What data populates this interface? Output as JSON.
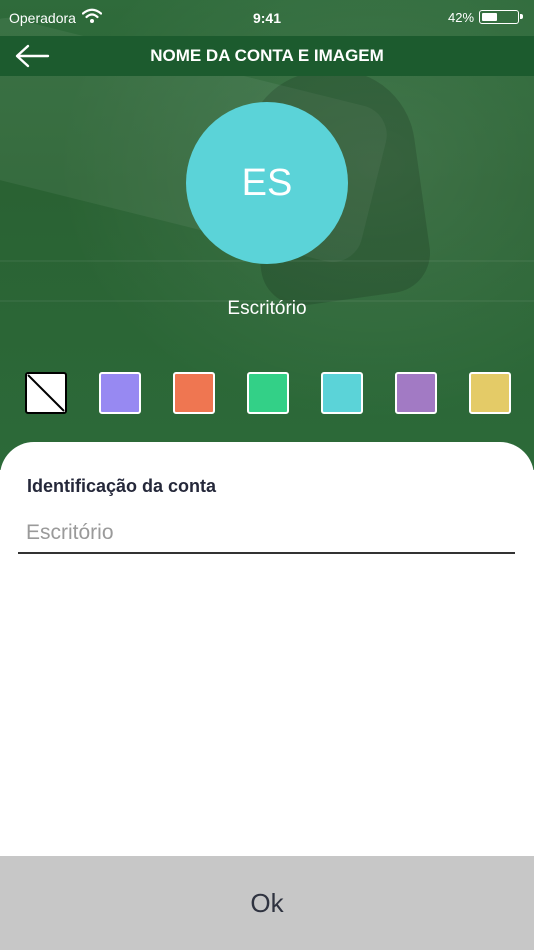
{
  "status_bar": {
    "carrier": "Operadora",
    "time": "9:41",
    "battery_percent": "42%",
    "battery_level": 0.42,
    "wifi_icon": "wifi-icon"
  },
  "header": {
    "back_icon": "arrow-left-icon",
    "title": "NOME DA CONTA E IMAGEM"
  },
  "avatar": {
    "initials": "ES",
    "color": "#5bd3d8",
    "name": "Escritório"
  },
  "colors": [
    {
      "name": "none",
      "hex": "#ffffff"
    },
    {
      "name": "lavender",
      "hex": "#9789f2"
    },
    {
      "name": "orange",
      "hex": "#ef7651"
    },
    {
      "name": "green",
      "hex": "#33d087"
    },
    {
      "name": "cyan",
      "hex": "#5bd3d8"
    },
    {
      "name": "purple",
      "hex": "#a27ac4"
    },
    {
      "name": "yellow",
      "hex": "#e4cb67"
    }
  ],
  "form": {
    "label": "Identificação da conta",
    "placeholder": "Escritório",
    "value": ""
  },
  "footer": {
    "ok_label": "Ok"
  },
  "theme": {
    "header_green": "#1c5b2e",
    "footer_gray": "#c7c7c7"
  }
}
